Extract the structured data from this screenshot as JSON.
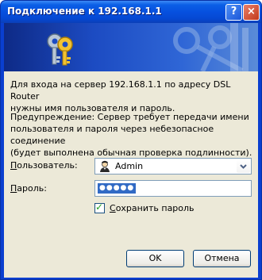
{
  "window": {
    "title": "Подключение к 192.168.1.1",
    "help_label": "?",
    "close_label": "×"
  },
  "banner": {
    "icon": "keys-icon"
  },
  "message": {
    "line1": "Для входа на сервер 192.168.1.1 по адресу DSL Router",
    "line2": "нужны имя пользователя и пароль."
  },
  "warning": {
    "line1": "Предупреждение: Сервер требует передачи имени",
    "line2": "пользователя и пароля через небезопасное соединение",
    "line3": "(будет выполнена обычная проверка подлинности)."
  },
  "form": {
    "user_label_access": "П",
    "user_label_rest": "ользователь:",
    "user_value": "Admin",
    "user_icon": "user-icon",
    "pass_label_access": "П",
    "pass_label_rest": "ароль:",
    "pass_value": "●●●●●",
    "save_label_pre": "",
    "save_label_access": "С",
    "save_label_rest": "охранить пароль",
    "save_checked": true
  },
  "buttons": {
    "ok": "OK",
    "cancel": "Отмена"
  }
}
